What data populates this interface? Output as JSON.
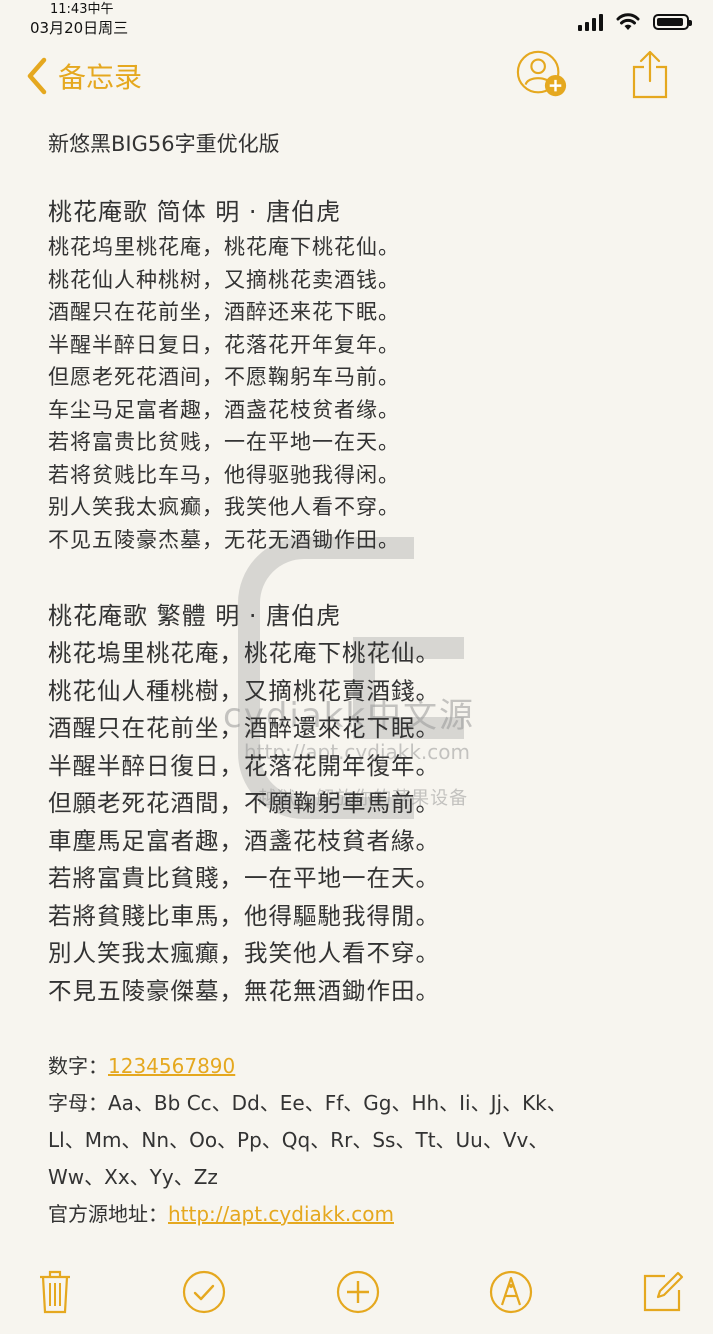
{
  "status": {
    "time": "11:43中午",
    "date": "03月20日周三"
  },
  "nav": {
    "back_label": "备忘录"
  },
  "note": {
    "title": "新悠黑BIG56字重优化版",
    "poem_simplified": {
      "heading": "桃花庵歌  简体   明  ·  唐伯虎",
      "lines": [
        "桃花坞里桃花庵，桃花庵下桃花仙。",
        "桃花仙人种桃树，又摘桃花卖酒钱。",
        "酒醒只在花前坐，酒醉还来花下眠。",
        "半醒半醉日复日，花落花开年复年。",
        "但愿老死花酒间，不愿鞠躬车马前。",
        "车尘马足富者趣，酒盏花枝贫者缘。",
        "若将富贵比贫贱，一在平地一在天。",
        "若将贫贱比车马，他得驱驰我得闲。",
        "别人笑我太疯癫，我笑他人看不穿。",
        "不见五陵豪杰墓，无花无酒锄作田。"
      ]
    },
    "poem_traditional": {
      "heading": "桃花庵歌  繁體      明  ·  唐伯虎",
      "lines": [
        "桃花塢里桃花庵，桃花庵下桃花仙。",
        "桃花仙人種桃樹，又摘桃花賣酒錢。",
        "酒醒只在花前坐，酒醉還來花下眠。",
        "半醒半醉日復日，花落花開年復年。",
        "但願老死花酒間，不願鞠躬車馬前。",
        "車塵馬足富者趣，酒盞花枝貧者緣。",
        "若將富貴比貧賤，一在平地一在天。",
        "若將貧賤比車馬，他得驅馳我得閒。",
        "別人笑我太瘋癲，我笑他人看不穿。",
        "不見五陵豪傑墓，無花無酒鋤作田。"
      ]
    },
    "digits_label": "数字：",
    "digits_value": "1234567890",
    "letters_label": "字母：",
    "letters_lines": [
      "Aa、Bb Cc、Dd、Ee、Ff、Gg、Hh、Ii、Jj、Kk、",
      "Ll、Mm、Nn、Oo、Pp、Qq、Rr、Ss、Tt、Uu、Vv、",
      "Ww、Xx、Yy、Zz"
    ],
    "source_label": "官方源地址：",
    "source_url": "http://apt.cydiakk.com"
  },
  "watermark": {
    "line1": "cydiakk中文源",
    "line2": "http://apt.cydiakk.com",
    "line3": "越狱 · 解放你的苹果设备"
  },
  "colors": {
    "accent": "#e5a81f",
    "background": "#f7f5ef",
    "text": "#333333"
  },
  "icons": {
    "back": "chevron-left-icon",
    "add_person": "add-person-icon",
    "share": "share-icon",
    "trash": "trash-icon",
    "checklist": "checkmark-circle-icon",
    "add": "plus-circle-icon",
    "markup": "pen-circle-icon",
    "compose": "compose-icon"
  }
}
